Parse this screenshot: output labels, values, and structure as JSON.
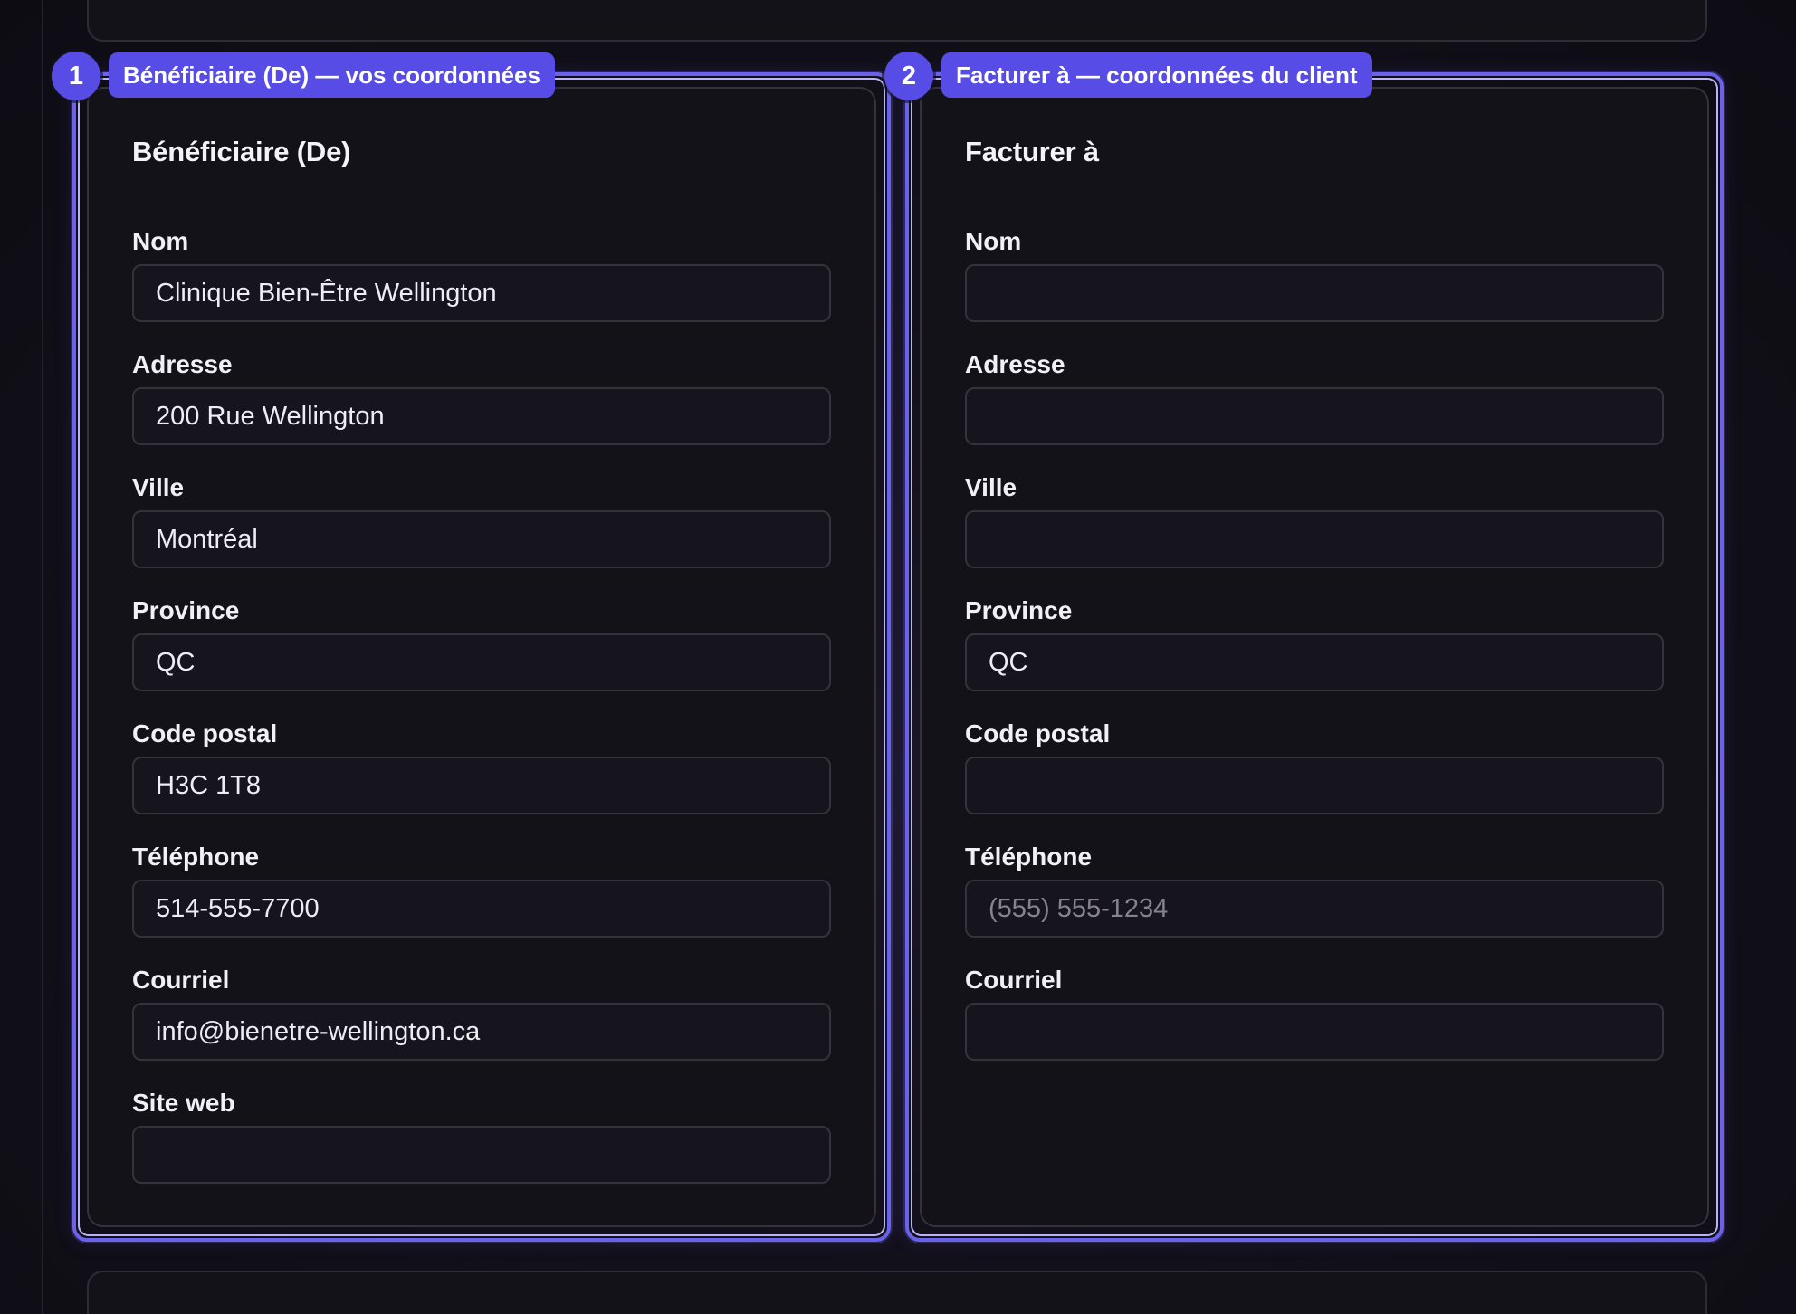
{
  "colors": {
    "accent": "#574de6",
    "highlight_border": "#6a63ea",
    "card_border": "#35323e",
    "background": "#100e16"
  },
  "annotations": [
    {
      "number": "1",
      "label": "Bénéficiaire (De) — vos coordonnées"
    },
    {
      "number": "2",
      "label": "Facturer à — coordonnées du client"
    }
  ],
  "from_card": {
    "title": "Bénéficiaire (De)",
    "fields": {
      "name": {
        "label": "Nom",
        "value": "Clinique Bien-Être Wellington",
        "placeholder": ""
      },
      "address": {
        "label": "Adresse",
        "value": "200 Rue Wellington",
        "placeholder": ""
      },
      "city": {
        "label": "Ville",
        "value": "Montréal",
        "placeholder": ""
      },
      "province": {
        "label": "Province",
        "value": "QC",
        "placeholder": ""
      },
      "postal": {
        "label": "Code postal",
        "value": "H3C 1T8",
        "placeholder": ""
      },
      "phone": {
        "label": "Téléphone",
        "value": "514-555-7700",
        "placeholder": ""
      },
      "email": {
        "label": "Courriel",
        "value": "info@bienetre-wellington.ca",
        "placeholder": ""
      },
      "website": {
        "label": "Site web",
        "value": "",
        "placeholder": ""
      }
    }
  },
  "to_card": {
    "title": "Facturer à",
    "fields": {
      "name": {
        "label": "Nom",
        "value": "",
        "placeholder": ""
      },
      "address": {
        "label": "Adresse",
        "value": "",
        "placeholder": ""
      },
      "city": {
        "label": "Ville",
        "value": "",
        "placeholder": ""
      },
      "province": {
        "label": "Province",
        "value": "QC",
        "placeholder": ""
      },
      "postal": {
        "label": "Code postal",
        "value": "",
        "placeholder": ""
      },
      "phone": {
        "label": "Téléphone",
        "value": "",
        "placeholder": "(555) 555-1234"
      },
      "email": {
        "label": "Courriel",
        "value": "",
        "placeholder": ""
      }
    }
  }
}
